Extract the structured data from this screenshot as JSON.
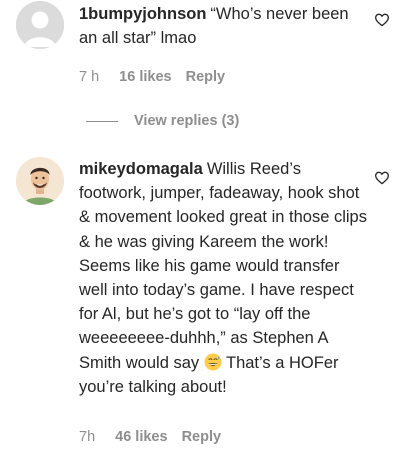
{
  "comments": [
    {
      "username": "1bumpyjohnson",
      "text": "“Who’s never been an all star” lmao",
      "time": "7 h",
      "likes": "16 likes",
      "reply_label": "Reply",
      "avatar_icon": "default-avatar-icon",
      "view_replies_label": "View replies (3)"
    },
    {
      "username": "mikeydomagala",
      "text_before_emoji": "Willis Reed’s footwork, jumper, fadeaway, hook shot & movement looked great in those clips & he was giving Kareem the work! Seems like his game would transfer well into today’s game. I have respect for Al, but he’s got to “lay off the weeeeeeee-duhhh,” as Stephen A Smith would say ",
      "emoji_name": "grinning-sweat-emoji",
      "text_after_emoji": " That’s a HOFer you’re talking about!",
      "time": "7h",
      "likes": "46 likes",
      "reply_label": "Reply",
      "avatar_icon": "profile-avatar-icon"
    }
  ],
  "colors": {
    "text": "#262626",
    "secondary": "#8e8e8e",
    "avatar_placeholder": "#dbdbdb",
    "emoji_yellow": "#ffcc4d"
  },
  "icons": {
    "like": "heart-outline-icon"
  }
}
